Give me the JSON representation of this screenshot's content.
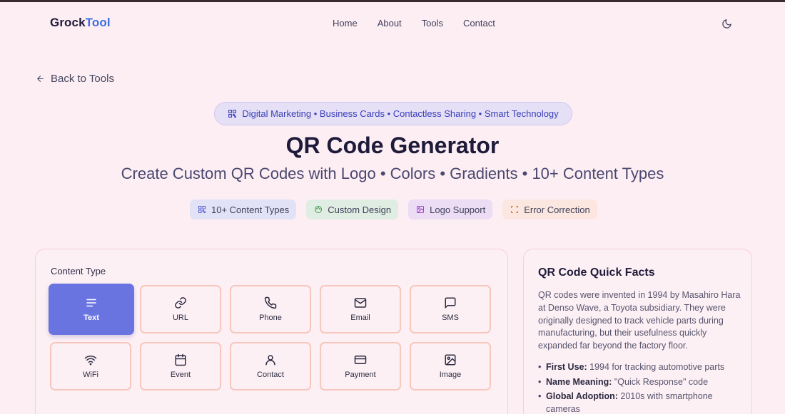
{
  "brand": {
    "part1": "Grock",
    "part2": "Tool",
    "accent_color": "#3d6fe0"
  },
  "nav": {
    "items": [
      "Home",
      "About",
      "Tools",
      "Contact"
    ],
    "theme_icon": "moon-icon"
  },
  "back_link": {
    "label": "Back to Tools",
    "icon": "arrow-left-icon"
  },
  "tag_pill": {
    "text": "Digital Marketing • Business Cards • Contactless Sharing • Smart Technology",
    "icon": "qr-icon"
  },
  "title": "QR Code Generator",
  "subtitle": "Create Custom QR Codes with Logo • Colors • Gradients • 10+ Content Types",
  "features": [
    {
      "label": "10+ Content Types",
      "icon": "qr-icon",
      "color": "#5a63d6"
    },
    {
      "label": "Custom Design",
      "icon": "palette-icon",
      "color": "#3f9a55"
    },
    {
      "label": "Logo Support",
      "icon": "image-icon",
      "color": "#9a45c8"
    },
    {
      "label": "Error Correction",
      "icon": "scan-icon",
      "color": "#e07a3a"
    }
  ],
  "content_type": {
    "label": "Content Type",
    "selected": "Text",
    "types": [
      {
        "label": "Text",
        "icon": "text-lines-icon"
      },
      {
        "label": "URL",
        "icon": "link-icon"
      },
      {
        "label": "Phone",
        "icon": "phone-icon"
      },
      {
        "label": "Email",
        "icon": "mail-icon"
      },
      {
        "label": "SMS",
        "icon": "message-icon"
      },
      {
        "label": "WiFi",
        "icon": "wifi-icon"
      },
      {
        "label": "Event",
        "icon": "calendar-icon"
      },
      {
        "label": "Contact",
        "icon": "user-icon"
      },
      {
        "label": "Payment",
        "icon": "credit-card-icon"
      },
      {
        "label": "Image",
        "icon": "image-icon"
      }
    ]
  },
  "facts": {
    "title": "QR Code Quick Facts",
    "paragraph": "QR codes were invented in 1994 by Masahiro Hara at Denso Wave, a Toyota subsidiary. They were originally designed to track vehicle parts during manufacturing, but their usefulness quickly expanded far beyond the factory floor.",
    "items": [
      {
        "term": "First Use:",
        "text": " 1994 for tracking automotive parts"
      },
      {
        "term": "Name Meaning:",
        "text": " \"Quick Response\" code"
      },
      {
        "term": "Global Adoption:",
        "text": " 2010s with smartphone cameras"
      }
    ]
  }
}
